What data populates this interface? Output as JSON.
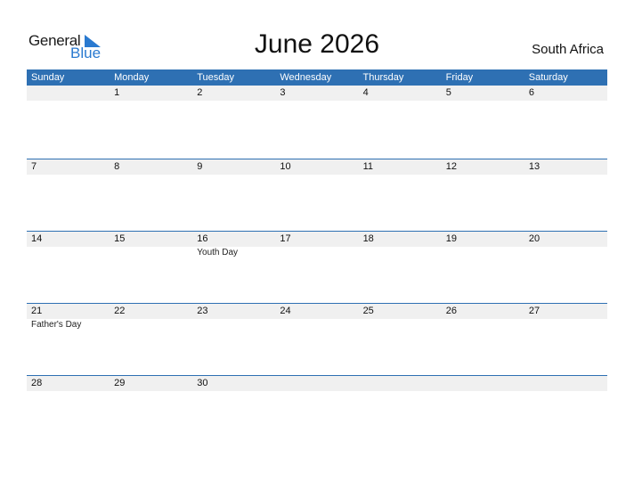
{
  "logo": {
    "word1": "General",
    "word2": "Blue"
  },
  "title": "June 2026",
  "country": "South Africa",
  "colors": {
    "header": "#2e70b3",
    "strip": "#f0f0f0",
    "logo_blue": "#2a7ad0"
  },
  "weekdays": [
    "Sunday",
    "Monday",
    "Tuesday",
    "Wednesday",
    "Thursday",
    "Friday",
    "Saturday"
  ],
  "weeks": [
    [
      {
        "day": ""
      },
      {
        "day": "1"
      },
      {
        "day": "2"
      },
      {
        "day": "3"
      },
      {
        "day": "4"
      },
      {
        "day": "5"
      },
      {
        "day": "6"
      }
    ],
    [
      {
        "day": "7"
      },
      {
        "day": "8"
      },
      {
        "day": "9"
      },
      {
        "day": "10"
      },
      {
        "day": "11"
      },
      {
        "day": "12"
      },
      {
        "day": "13"
      }
    ],
    [
      {
        "day": "14"
      },
      {
        "day": "15"
      },
      {
        "day": "16",
        "event": "Youth Day"
      },
      {
        "day": "17"
      },
      {
        "day": "18"
      },
      {
        "day": "19"
      },
      {
        "day": "20"
      }
    ],
    [
      {
        "day": "21",
        "event": "Father's Day"
      },
      {
        "day": "22"
      },
      {
        "day": "23"
      },
      {
        "day": "24"
      },
      {
        "day": "25"
      },
      {
        "day": "26"
      },
      {
        "day": "27"
      }
    ],
    [
      {
        "day": "28"
      },
      {
        "day": "29"
      },
      {
        "day": "30"
      },
      {
        "day": ""
      },
      {
        "day": ""
      },
      {
        "day": ""
      },
      {
        "day": ""
      }
    ]
  ]
}
